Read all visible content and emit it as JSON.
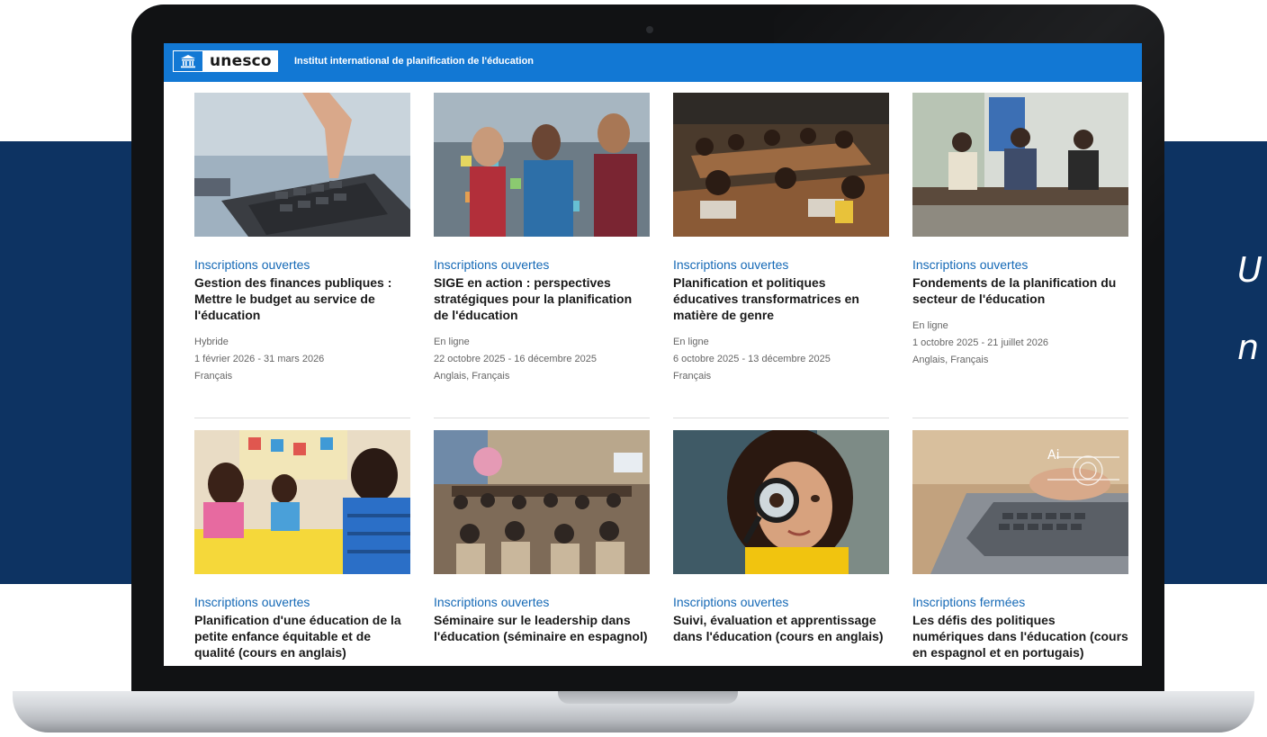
{
  "background": {
    "band_color": "#0d3362",
    "side_text_line1": "U",
    "side_text_line2": "n"
  },
  "header": {
    "logo_text": "unesco",
    "logo_icon": "temple-icon",
    "title": "Institut international de planification de l'éducation",
    "bar_color": "#1278d4"
  },
  "courses": [
    {
      "status": "Inscriptions ouvertes",
      "title": "Gestion des finances publiques : Mettre le budget au service de l'éducation",
      "format": "Hybride",
      "dates": "1 février 2026 - 31 mars 2026",
      "languages": "Français",
      "image": "calculator-photo"
    },
    {
      "status": "Inscriptions ouvertes",
      "title": "SIGE en action : perspectives stratégiques pour la planification de l'éducation",
      "format": "En ligne",
      "dates": "22 octobre 2025 - 16 décembre 2025",
      "languages": "Anglais, Français",
      "image": "team-sticky-notes-photo"
    },
    {
      "status": "Inscriptions ouvertes",
      "title": "Planification et politiques éducatives transformatrices en matière de genre",
      "format": "En ligne",
      "dates": "6 octobre 2025 - 13 décembre 2025",
      "languages": "Français",
      "image": "classroom-photo"
    },
    {
      "status": "Inscriptions ouvertes",
      "title": "Fondements de la planification du secteur de l'éducation",
      "format": "En ligne",
      "dates": "1 octobre 2025 - 21 juillet 2026",
      "languages": "Anglais, Français",
      "image": "panel-photo"
    },
    {
      "status": "Inscriptions ouvertes",
      "title": "Planification d'une éducation de la petite enfance équitable et de qualité (cours en anglais)",
      "image": "children-drawing-photo"
    },
    {
      "status": "Inscriptions ouvertes",
      "title": "Séminaire sur le leadership dans l'éducation (séminaire en espagnol)",
      "image": "seminar-room-photo"
    },
    {
      "status": "Inscriptions ouvertes",
      "title": "Suivi, évaluation et apprentissage dans l'éducation (cours en anglais)",
      "image": "girl-magnifier-photo"
    },
    {
      "status": "Inscriptions fermées",
      "title": "Les défis des politiques numériques dans l'éducation (cours en espagnol et en portugais)",
      "image": "ai-laptop-photo"
    }
  ]
}
